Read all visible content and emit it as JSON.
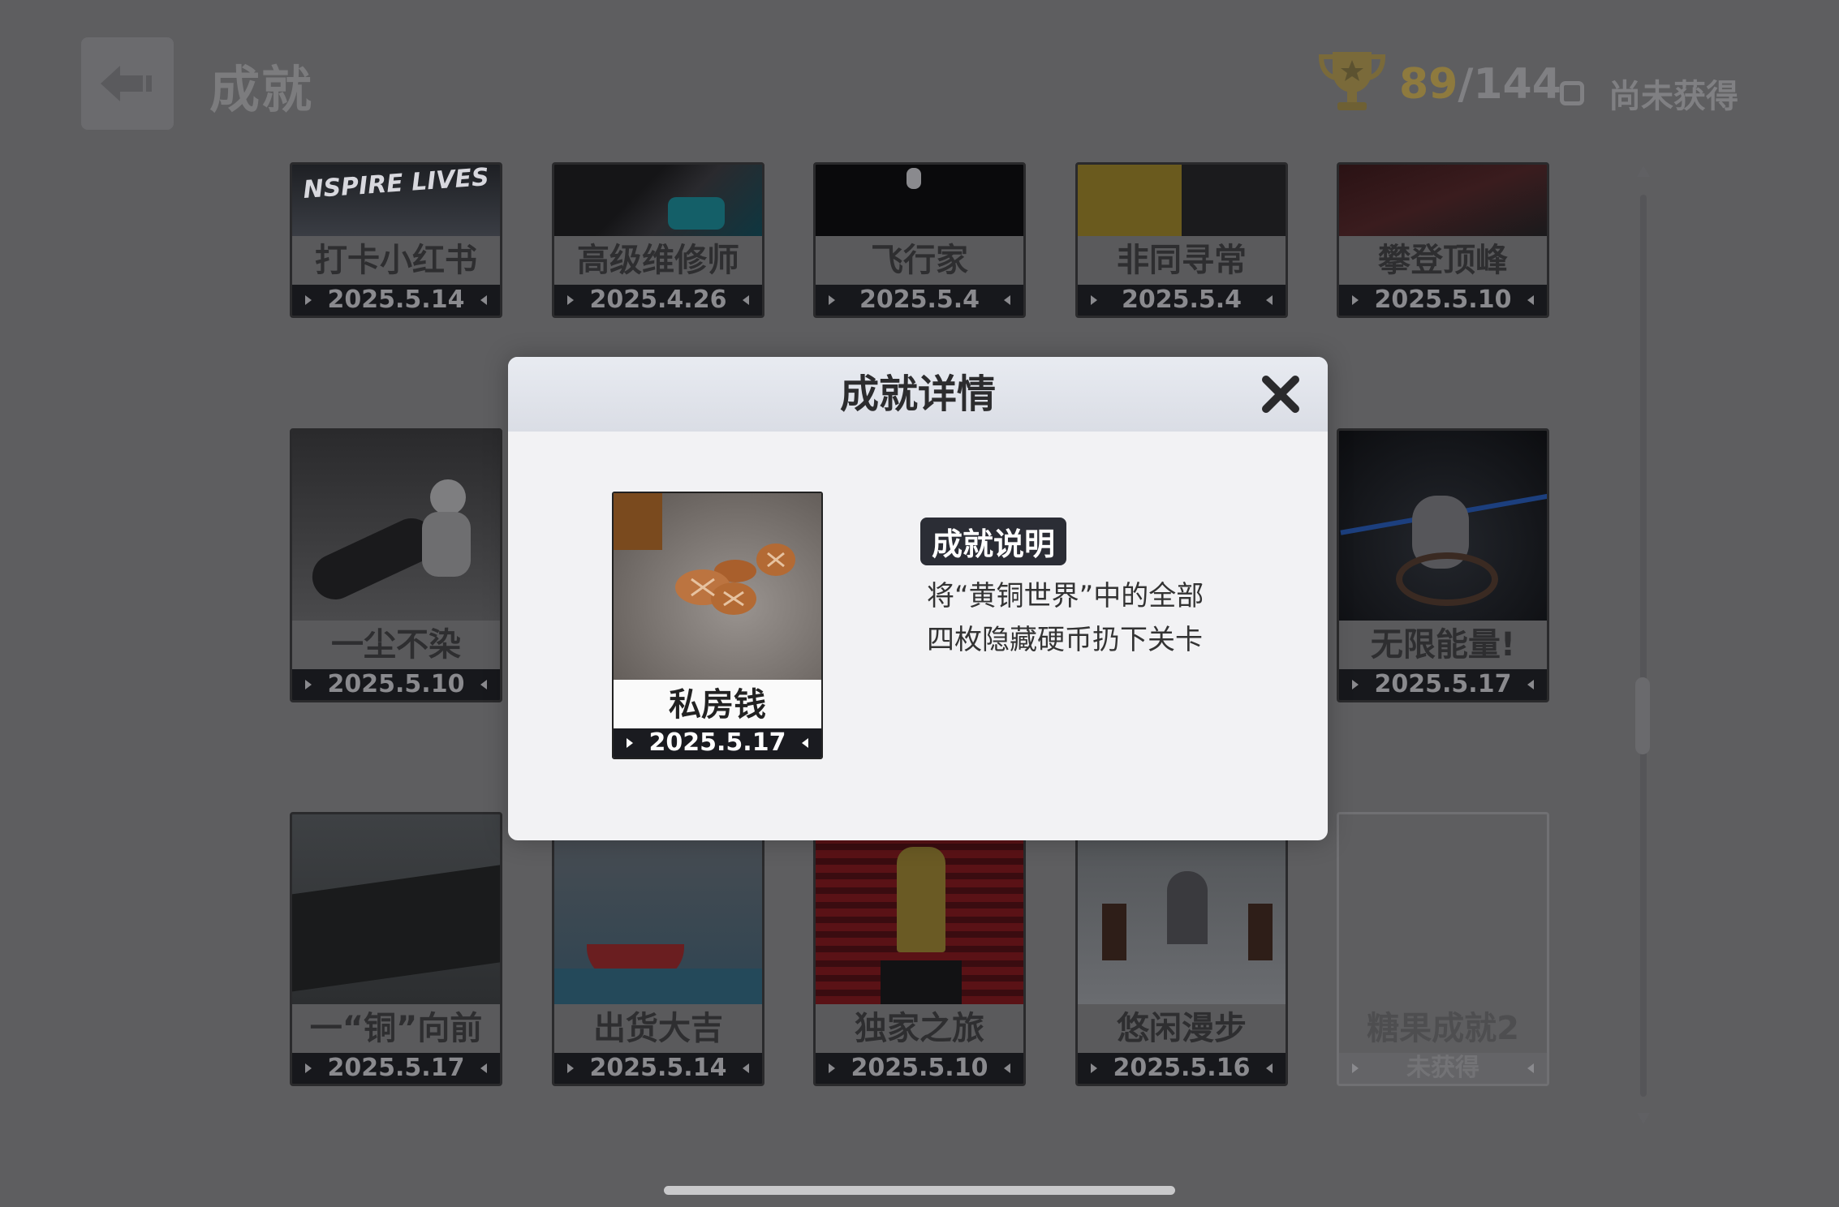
{
  "header": {
    "title": "成就",
    "progress_current": "89",
    "progress_total": "/144",
    "filter_label": "尚未获得",
    "filter_checked": false
  },
  "icons": {
    "back": "back-arrow-icon",
    "trophy": "trophy-icon",
    "close": "close-icon"
  },
  "achievements": [
    {
      "name": "打卡小红书",
      "date": "2025.5.14"
    },
    {
      "name": "高级维修师",
      "date": "2025.4.26"
    },
    {
      "name": "飞行家",
      "date": "2025.5.4"
    },
    {
      "name": "非同寻常",
      "date": "2025.5.4"
    },
    {
      "name": "攀登顶峰",
      "date": "2025.5.10"
    },
    {
      "name": "一尘不染",
      "date": "2025.5.10"
    },
    {
      "name": "无限能量!",
      "date": "2025.5.17"
    },
    {
      "name": "一“铜”向前",
      "date": "2025.5.17"
    },
    {
      "name": "出货大吉",
      "date": "2025.5.14"
    },
    {
      "name": "独家之旅",
      "date": "2025.5.10"
    },
    {
      "name": "悠闲漫步",
      "date": "2025.5.16"
    },
    {
      "name": "糖果成就2",
      "date": "未获得"
    }
  ],
  "thumb_texts": {
    "banner": "NSPIRE LIVES"
  },
  "dialog": {
    "title": "成就详情",
    "achievement_name": "私房钱",
    "achievement_date": "2025.5.17",
    "desc_label": "成就说明",
    "desc_line1": "将“黄铜世界”中的全部",
    "desc_line2": "四枚隐藏硬币扔下关卡"
  },
  "colors": {
    "background": "#5e5e60",
    "dialog_bg": "#f2f2f4",
    "date_bar": "#17181c",
    "tag_bg": "#2b2d35",
    "progress_gold": "#8e7a3e"
  }
}
